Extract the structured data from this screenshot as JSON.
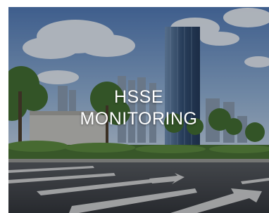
{
  "tile": {
    "title_line1": "HSSE",
    "title_line2": "MONITORING",
    "image_subject": "city-street-skyline-photo"
  },
  "colors": {
    "sky_top": "#4f79b8",
    "sky_bottom": "#bfd3ea",
    "road": "#3c3f44",
    "foliage": "#3f6b2c",
    "title_text": "#ffffff"
  }
}
